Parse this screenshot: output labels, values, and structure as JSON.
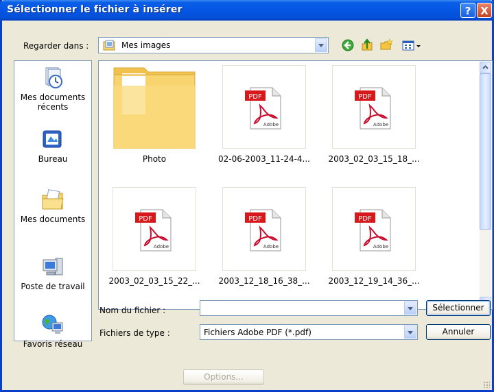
{
  "window": {
    "title": "Sélectionner le fichier à insérer",
    "help_label": "?",
    "close_label": "X"
  },
  "toolbar": {
    "look_in_label": "Regarder dans :",
    "look_in_value": "Mes images",
    "icons": [
      "back-icon",
      "up-folder-icon",
      "new-folder-icon",
      "view-menu-icon"
    ]
  },
  "places": [
    {
      "label": "Mes documents récents",
      "icon": "recent-documents-icon"
    },
    {
      "label": "Bureau",
      "icon": "desktop-icon"
    },
    {
      "label": "Mes documents",
      "icon": "my-documents-icon"
    },
    {
      "label": "Poste de travail",
      "icon": "my-computer-icon"
    },
    {
      "label": "Favoris réseau",
      "icon": "network-places-icon"
    }
  ],
  "files": [
    {
      "name": "Photo",
      "type": "folder"
    },
    {
      "name": "02-06-2003_11-24-4...",
      "type": "pdf"
    },
    {
      "name": "2003_02_03_15_18_...",
      "type": "pdf"
    },
    {
      "name": "2003_02_03_15_22_...",
      "type": "pdf"
    },
    {
      "name": "2003_12_18_16_38_...",
      "type": "pdf"
    },
    {
      "name": "2003_12_19_14_36_...",
      "type": "pdf"
    }
  ],
  "pdf_icon": {
    "badge": "PDF",
    "brand": "Adobe"
  },
  "form": {
    "filename_label": "Nom du fichier :",
    "filename_value": "",
    "filetype_label": "Fichiers de type :",
    "filetype_value": "Fichiers Adobe PDF (*.pdf)",
    "select_button": "Sélectionner",
    "cancel_button": "Annuler",
    "options_button": "Options..."
  },
  "colors": {
    "title_bar": "#0456E3",
    "dialog_bg": "#ECE9D8",
    "pdf_red": "#D7191C",
    "folder_yellow": "#F8D46E"
  }
}
